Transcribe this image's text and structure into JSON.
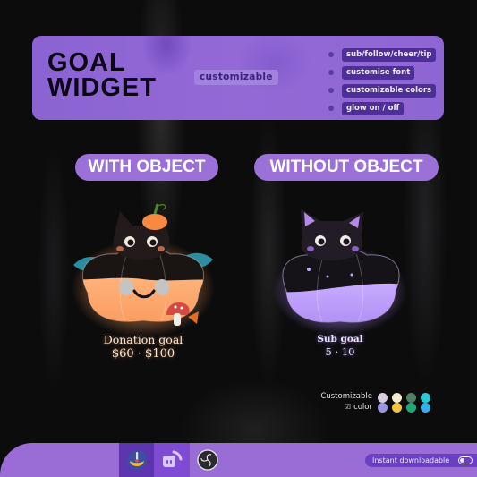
{
  "header": {
    "title_line1": "GOAL",
    "title_line2": "WIDGET",
    "badge": "customizable",
    "features": [
      "sub/follow/cheer/tip",
      "customise font",
      "customizable colors",
      "glow on / off"
    ]
  },
  "sections": {
    "with_object": {
      "label": "WITH OBJECT",
      "goal_title": "Donation goal",
      "goal_value": "$60 · $100",
      "fill_fraction": 0.6,
      "accent": "#f59a5a"
    },
    "without_object": {
      "label": "WITHOUT OBJECT",
      "goal_title": "Sub goal",
      "goal_value": "5 · 10",
      "fill_fraction": 0.5,
      "accent": "#a98ef0"
    }
  },
  "colors_legend": {
    "line1": "Customizable",
    "line2": "color",
    "check_icon": "checkbox-icon",
    "swatches": [
      [
        "#d7cfe0",
        "#f3edd0",
        "#4f7f66",
        "#2fc6d8"
      ],
      [
        "#9c96e0",
        "#f3c442",
        "#21a876",
        "#36b0e6"
      ]
    ]
  },
  "footer": {
    "platforms": [
      "streamlabs",
      "twitch",
      "obs"
    ],
    "download_label": "Instant downloadable"
  },
  "theme": {
    "primary": "#9a6dd6",
    "dark_purple": "#4e2f9a",
    "background": "#0c0c0d"
  }
}
